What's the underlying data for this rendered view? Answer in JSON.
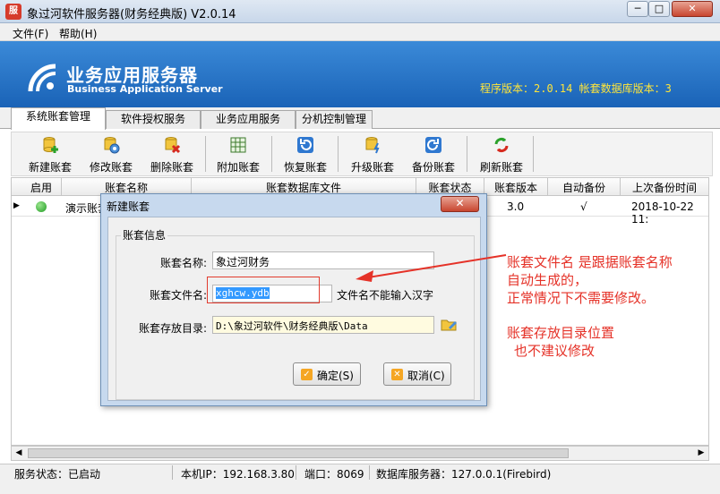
{
  "window": {
    "icon_text": "服",
    "title": "象过河软件服务器(财务经典版) V2.0.14",
    "min": "─",
    "max": "□",
    "close": "✕"
  },
  "menu": [
    "文件(F)",
    "帮助(H)"
  ],
  "banner": {
    "title": "业务应用服务器",
    "subtitle": "Business Application Server",
    "version_text": "程序版本：2.0.14  帐套数据库版本：3"
  },
  "tabs": [
    "系统账套管理",
    "软件授权服务",
    "业务应用服务",
    "分机控制管理"
  ],
  "toolbar": [
    "新建账套",
    "修改账套",
    "删除账套",
    "附加账套",
    "恢复账套",
    "升级账套",
    "备份账套",
    "刷新账套"
  ],
  "grid": {
    "headers": [
      "启用",
      "账套名称",
      "账套数据库文件",
      "账套状态",
      "账套版本",
      "自动备份",
      "上次备份时间"
    ],
    "rows": [
      {
        "name": "演示账套",
        "file": "",
        "status": "",
        "version": "3.0",
        "backup": "√",
        "last_backup": "2018-10-22 11:"
      }
    ]
  },
  "statusbar": {
    "service": "服务状态：已启动",
    "ip": "本机IP：192.168.3.80",
    "port": "端口：8069",
    "db": "数据库服务器：127.0.0.1(Firebird)"
  },
  "dialog": {
    "title": "新建账套",
    "close": "✕",
    "group": "账套信息",
    "name_label": "账套名称:",
    "name_value": "象过河财务",
    "file_label": "账套文件名:",
    "file_value": "xghcw.ydb",
    "file_hint": "文件名不能输入汉字",
    "dir_label": "账套存放目录:",
    "dir_value": "D:\\象过河软件\\财务经典版\\Data",
    "ok": "确定(S)",
    "cancel": "取消(C)"
  },
  "annotations": {
    "note1_line1": "账套文件名 是跟据账套名称",
    "note1_line2": "自动生成的，",
    "note1_line3": "正常情况下不需要修改。",
    "note2_line1": "账套存放目录位置",
    "note2_line2": "也不建议修改"
  }
}
